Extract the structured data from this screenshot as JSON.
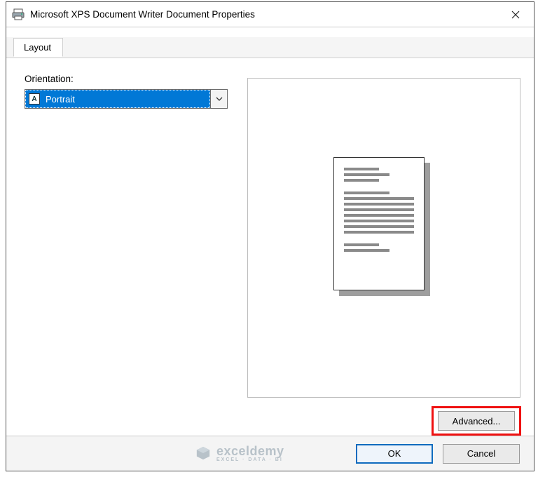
{
  "window": {
    "title": "Microsoft XPS Document Writer Document Properties"
  },
  "tabs": {
    "layout": "Layout"
  },
  "orientation": {
    "label": "Orientation:",
    "value": "Portrait",
    "glyph": "A"
  },
  "buttons": {
    "advanced": "Advanced...",
    "ok": "OK",
    "cancel": "Cancel"
  },
  "watermark": {
    "name": "exceldemy",
    "tagline": "EXCEL · DATA · BI"
  }
}
